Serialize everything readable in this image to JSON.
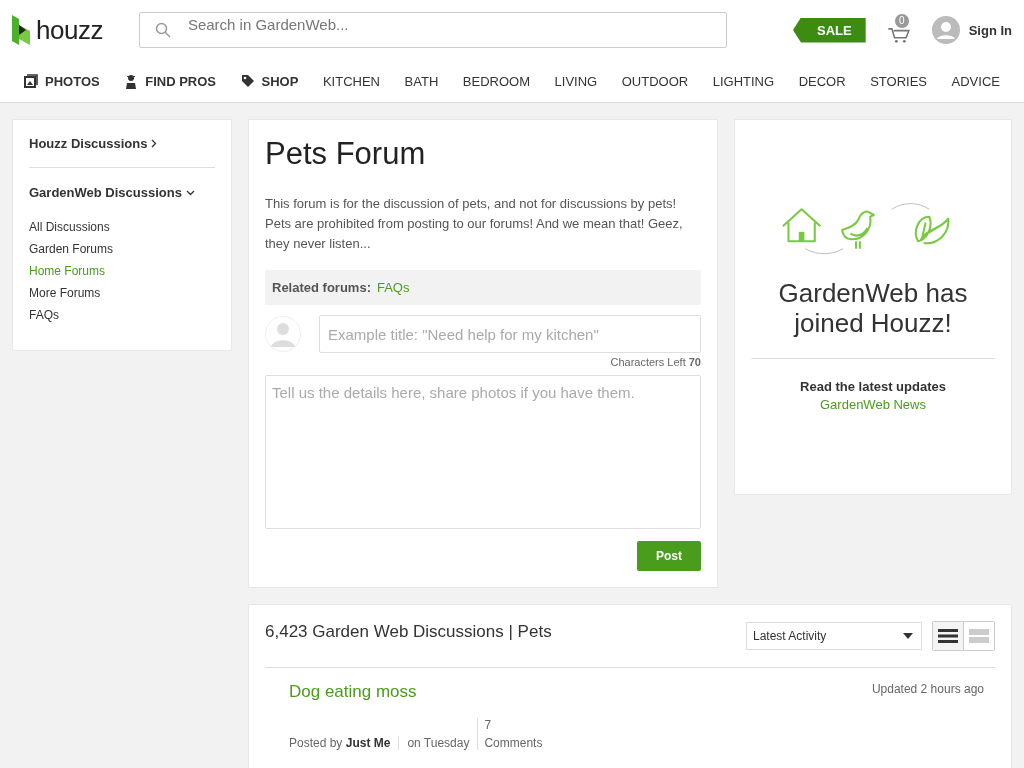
{
  "header": {
    "logo": "houzz",
    "search": {
      "placeholder": "Search in GardenWeb..."
    },
    "sale": "SALE",
    "cart_count": "0",
    "sign_in": "Sign In"
  },
  "nav": [
    {
      "label": "PHOTOS",
      "kind": "featured"
    },
    {
      "label": "FIND PROS",
      "kind": "featured"
    },
    {
      "label": "SHOP",
      "kind": "featured"
    },
    {
      "label": "KITCHEN",
      "kind": "plain"
    },
    {
      "label": "BATH",
      "kind": "plain"
    },
    {
      "label": "BEDROOM",
      "kind": "plain"
    },
    {
      "label": "LIVING",
      "kind": "plain"
    },
    {
      "label": "OUTDOOR",
      "kind": "plain"
    },
    {
      "label": "LIGHTING",
      "kind": "plain"
    },
    {
      "label": "DECOR",
      "kind": "plain"
    },
    {
      "label": "STORIES",
      "kind": "plain"
    },
    {
      "label": "ADVICE",
      "kind": "plain"
    }
  ],
  "sidebar": {
    "sections": [
      {
        "title": "Houzz Discussions",
        "expanded": false
      },
      {
        "title": "GardenWeb Discussions",
        "expanded": true,
        "items": [
          {
            "label": "All Discussions",
            "selected": false
          },
          {
            "label": "Garden Forums",
            "selected": false
          },
          {
            "label": "Home Forums",
            "selected": true
          },
          {
            "label": "More Forums",
            "selected": false
          },
          {
            "label": "FAQs",
            "selected": false
          }
        ]
      }
    ]
  },
  "forum": {
    "title": "Pets Forum",
    "description": "This forum is for the discussion of pets, and not for discussions by pets! Pets are prohibited from posting to our forums! And we mean that! Geez, they never listen...",
    "related_label": "Related forums:",
    "related_links": [
      "FAQs"
    ],
    "title_field": {
      "placeholder": "Example title: \"Need help for my kitchen\""
    },
    "chars_left": "Characters Left **70**",
    "body_field": {
      "placeholder": "Tell us the details here, share photos if you have them."
    },
    "post_button": "Post"
  },
  "promo": {
    "headline": "GardenWeb has joined Houzz!",
    "updates_label": "Read the latest updates",
    "news_link": "GardenWeb News"
  },
  "discussions": {
    "heading": "6,423 Garden Web Discussions | Pets",
    "sort": {
      "value": "Latest Activity"
    },
    "view_modes": [
      {
        "selected": true
      },
      {
        "selected": false
      }
    ],
    "threads": [
      {
        "title": "Dog eating moss",
        "updated": "Updated 2 hours ago",
        "posted_by": "Posted by **Just Me**",
        "date": "on Tuesday",
        "comments_count": "7",
        "comments_label": "Comments"
      }
    ]
  }
}
